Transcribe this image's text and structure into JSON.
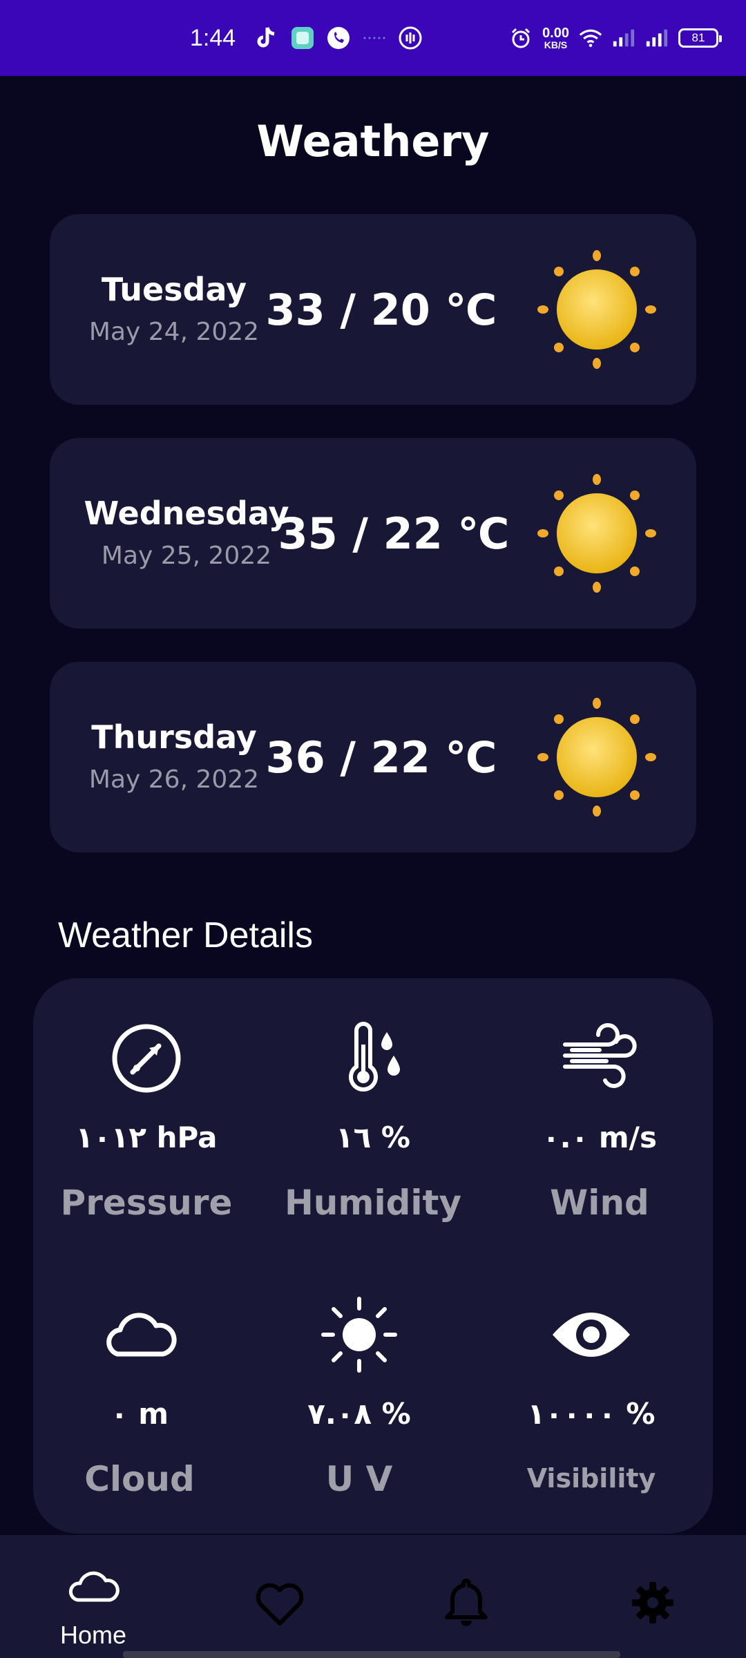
{
  "status_bar": {
    "time": "1:44",
    "net_speed_value": "0.00",
    "net_speed_unit": "KB/S",
    "battery": "81",
    "icons": [
      "tiktok-icon",
      "app-icon",
      "phone-icon",
      "dots-icon",
      "sound-icon",
      "alarm-icon",
      "wifi-icon",
      "signal-icon",
      "signal-icon"
    ]
  },
  "app": {
    "title": "Weathery"
  },
  "forecast": [
    {
      "day": "Tuesday",
      "date": "May 24, 2022",
      "temp": "33 / 20 ℃",
      "icon": "sun-icon"
    },
    {
      "day": "Wednesday",
      "date": "May 25, 2022",
      "temp": "35 / 22 ℃",
      "icon": "sun-icon"
    },
    {
      "day": "Thursday",
      "date": "May 26, 2022",
      "temp": "36 / 22 ℃",
      "icon": "sun-icon"
    }
  ],
  "details": {
    "heading": "Weather Details",
    "items": [
      {
        "value": "١٠١٢ hPa",
        "label": "Pressure",
        "icon": "gauge-icon"
      },
      {
        "value": "١٦ %",
        "label": "Humidity",
        "icon": "thermometer-drops-icon"
      },
      {
        "value": "٠.٠ m/s",
        "label": "Wind",
        "icon": "wind-icon"
      },
      {
        "value": "٠ m",
        "label": "Cloud",
        "icon": "cloud-icon"
      },
      {
        "value": "٧.٠٨ %",
        "label": "U V",
        "icon": "sun-outline-icon"
      },
      {
        "value": "١٠٠٠٠ %",
        "label": "Visibility",
        "icon": "eye-icon"
      }
    ]
  },
  "nav": {
    "items": [
      {
        "label": "Home",
        "icon": "cloud-icon",
        "active": true
      },
      {
        "label": "",
        "icon": "heart-icon",
        "active": false
      },
      {
        "label": "",
        "icon": "bell-icon",
        "active": false
      },
      {
        "label": "",
        "icon": "gear-icon",
        "active": false
      }
    ]
  },
  "colors": {
    "status_bar": "#3a06b8",
    "background": "#08071f",
    "card": "#181735",
    "muted_text": "#9a9aa8",
    "sun": "#f2c230"
  }
}
